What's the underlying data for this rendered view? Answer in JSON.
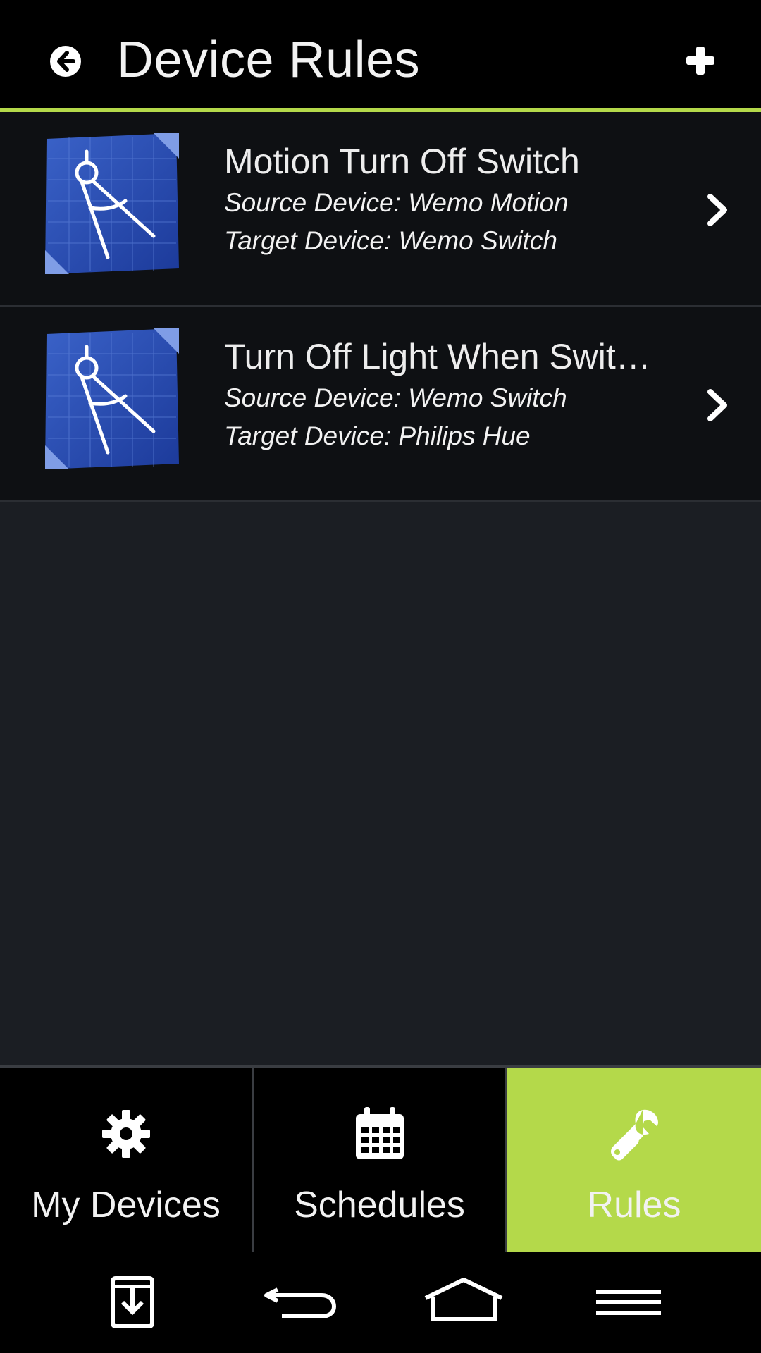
{
  "header": {
    "title": "Device Rules",
    "back_icon": "arrow-left-circle-icon",
    "add_icon": "plus-icon",
    "accent_color": "#b4d94a"
  },
  "rules": [
    {
      "name": "Motion Turn Off Switch",
      "source": "Source Device: Wemo Motion",
      "target": "Target Device: Wemo Switch",
      "icon": "blueprint-compass-icon"
    },
    {
      "name": "Turn Off Light When Switch Turns Off",
      "source": "Source Device: Wemo Switch",
      "target": "Target Device: Philips Hue",
      "icon": "blueprint-compass-icon"
    }
  ],
  "tabs": [
    {
      "label": "My Devices",
      "icon": "gear-icon",
      "active": false
    },
    {
      "label": "Schedules",
      "icon": "calendar-icon",
      "active": false
    },
    {
      "label": "Rules",
      "icon": "wrench-icon",
      "active": true
    }
  ],
  "system_nav": {
    "icons": [
      "download-icon",
      "back-icon",
      "home-icon",
      "menu-icon"
    ]
  }
}
